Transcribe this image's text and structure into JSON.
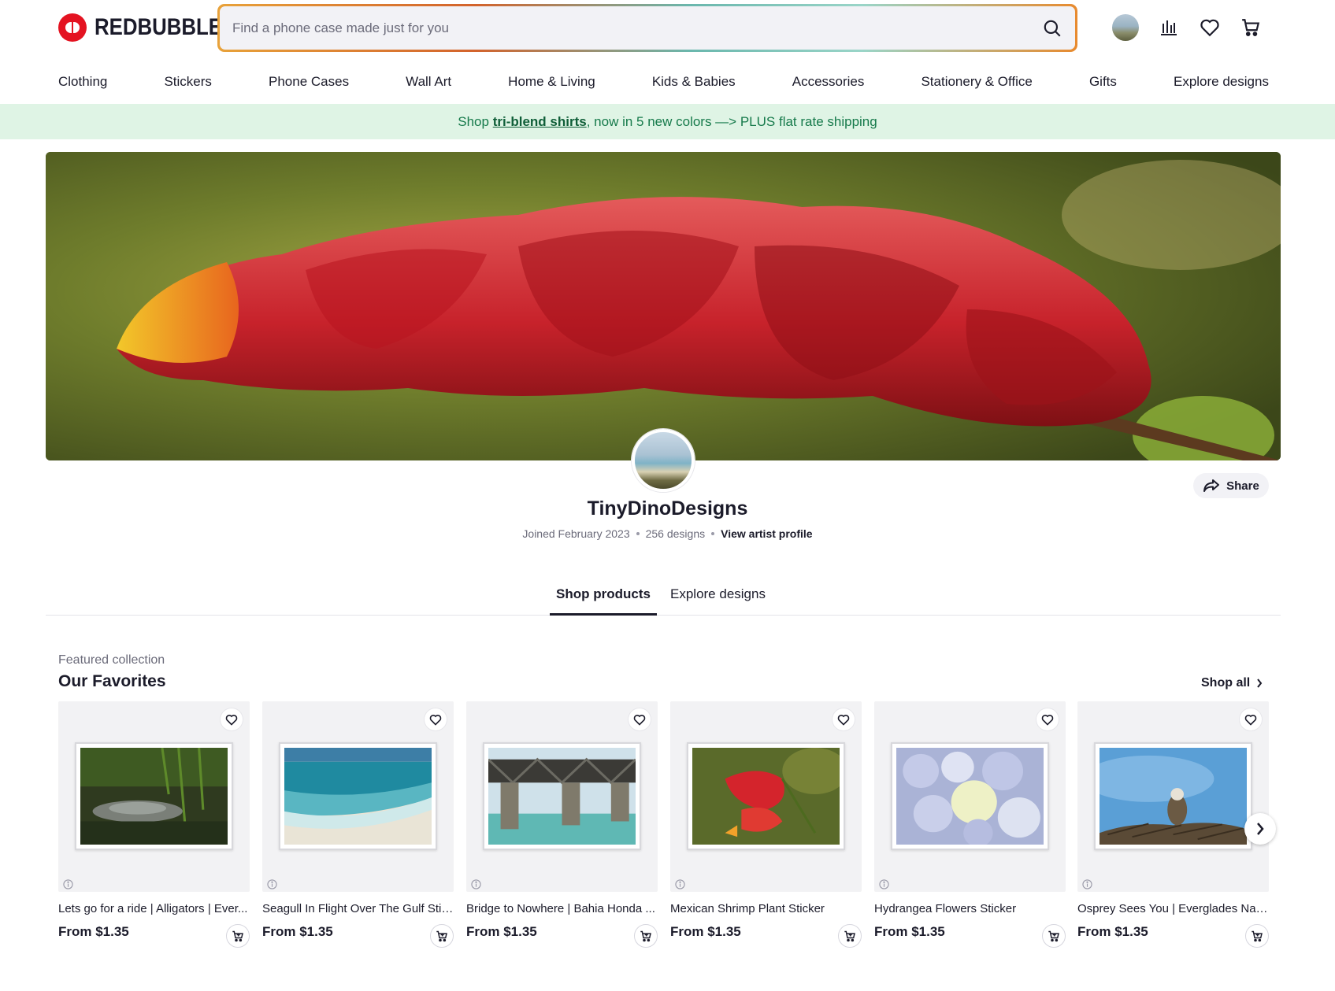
{
  "brand": {
    "name": "REDBUBBLE"
  },
  "search": {
    "placeholder": "Find a phone case made just for you"
  },
  "nav": [
    "Clothing",
    "Stickers",
    "Phone Cases",
    "Wall Art",
    "Home & Living",
    "Kids & Babies",
    "Accessories",
    "Stationery & Office",
    "Gifts",
    "Explore designs"
  ],
  "promo": {
    "prefix": "Shop",
    "link": "tri-blend shirts",
    "suffix": ", now in 5 new colors —> PLUS flat rate shipping"
  },
  "profile": {
    "name": "TinyDinoDesigns",
    "joined": "Joined February 2023",
    "designs": "256 designs",
    "view_profile": "View artist profile",
    "share_label": "Share"
  },
  "tabs": {
    "shop": "Shop products",
    "explore": "Explore designs"
  },
  "collection": {
    "subtitle": "Featured collection",
    "title": "Our Favorites",
    "shop_all": "Shop all",
    "items": [
      {
        "title": "Lets go for a ride | Alligators | Ever...",
        "price": "From $1.35"
      },
      {
        "title": "Seagull In Flight Over The Gulf Stic...",
        "price": "From $1.35"
      },
      {
        "title": "Bridge to Nowhere | Bahia Honda ...",
        "price": "From $1.35"
      },
      {
        "title": "Mexican Shrimp Plant Sticker",
        "price": "From $1.35"
      },
      {
        "title": "Hydrangea Flowers Sticker",
        "price": "From $1.35"
      },
      {
        "title": "Osprey Sees You | Everglades Nati...",
        "price": "From $1.35"
      }
    ]
  },
  "colors": {
    "brand_red": "#e41321",
    "promo_bg": "#dff4e5",
    "promo_text": "#167a4b",
    "text": "#1b1b2a"
  }
}
